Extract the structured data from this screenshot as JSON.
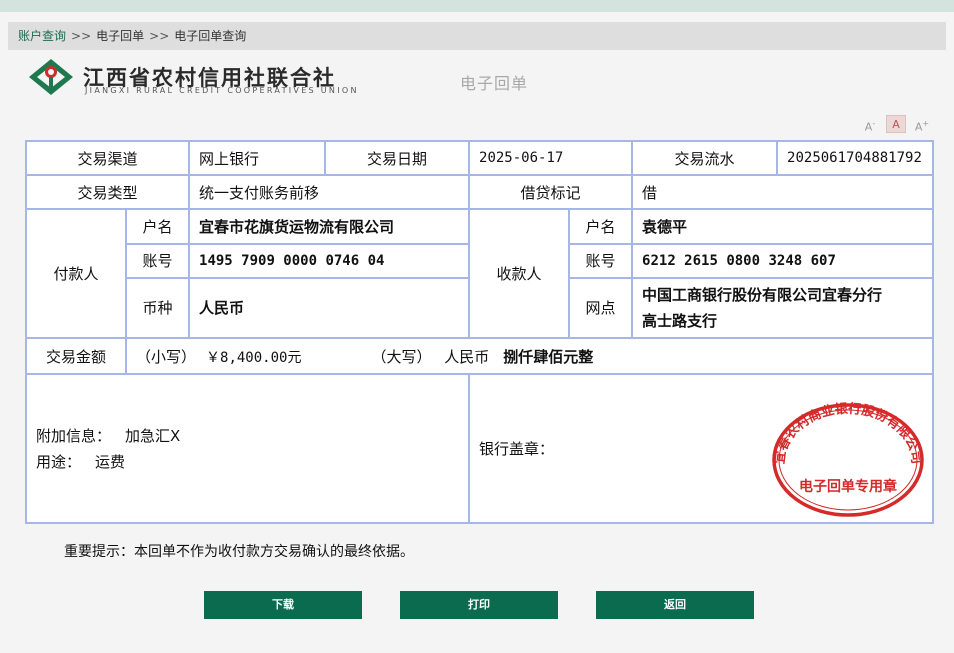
{
  "breadcrumb": {
    "items": [
      "账户查询",
      "电子回单",
      "电子回单查询"
    ],
    "separator": ">>"
  },
  "header": {
    "bank_name_cn": "江西省农村信用社联合社",
    "bank_name_en": "JIANGXI RURAL CREDIT COOPERATIVES UNION",
    "doc_title": "电子回单"
  },
  "font_controls": {
    "decrease": "A",
    "normal": "A",
    "increase": "A",
    "decrease_mark": "-",
    "increase_mark": "+"
  },
  "receipt": {
    "channel_label": "交易渠道",
    "channel_value": "网上银行",
    "date_label": "交易日期",
    "date_value": "2025-06-17",
    "serial_label": "交易流水",
    "serial_value": "2025061704881792",
    "type_label": "交易类型",
    "type_value": "统一支付账务前移",
    "dc_label": "借贷标记",
    "dc_value": "借",
    "payer_label": "付款人",
    "payee_label": "收款人",
    "name_label": "户名",
    "account_label": "账号",
    "currency_label": "币种",
    "branch_label": "网点",
    "payer_name": "宜春市花旗货运物流有限公司",
    "payer_account": "1495 7909 0000 0746 04",
    "payer_currency": "人民币",
    "payee_name": "袁德平",
    "payee_account": "6212 2615 0800 3248 607",
    "payee_branch_line1": "中国工商银行股份有限公司宜春分行",
    "payee_branch_line2": "高士路支行",
    "amount_label": "交易金额",
    "amount_small_label": "（小写）",
    "amount_small_value": "￥8,400.00元",
    "amount_big_label": "（大写）",
    "amount_big_currency": "人民币",
    "amount_big_value": "捌仟肆佰元整",
    "extra_label": "附加信息：",
    "extra_value": "加急汇X",
    "purpose_label": "用途：",
    "purpose_value": "运费",
    "seal_label": "银行盖章："
  },
  "seal": {
    "arc_text": "宜春农村商业银行股份有限公司",
    "center_text": "电子回单专用章",
    "color": "#d42a2a"
  },
  "notice": "重要提示：本回单不作为收付款方交易确认的最终依据。",
  "buttons": {
    "download": "下载",
    "print": "打印",
    "back": "返回"
  },
  "colors": {
    "accent": "#0a6b4e",
    "table_border": "#a7b6e4",
    "link": "#1f6a52"
  }
}
